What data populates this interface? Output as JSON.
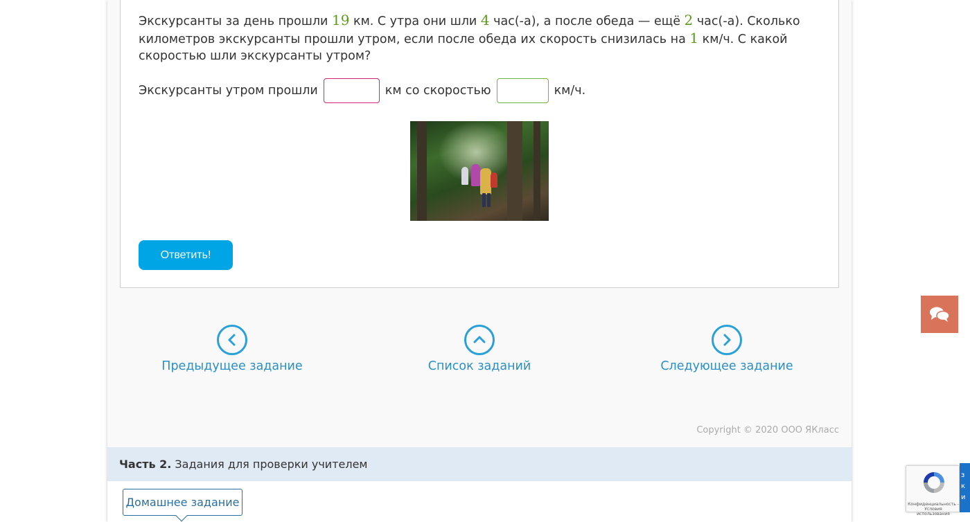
{
  "task": {
    "text_parts": {
      "a": "Экскурсанты за день прошли ",
      "n1": "19",
      "b": " км. С утра они шли ",
      "n2": "4",
      "c": " час(-а), а после обеда — ещё ",
      "n3": "2",
      "d": " час(-а). Сколько километров экскурсанты прошли утром, если после обеда их скорость снизилась на ",
      "n4": "1",
      "e": " км/ч. С какой скоростью шли экскурсанты утром?"
    },
    "answer_prefix": "Экскурсанты утром прошли",
    "answer_middle": "км со скоростью",
    "answer_suffix": "км/ч.",
    "distance_value": "",
    "speed_value": "",
    "submit_label": "Ответить!"
  },
  "navigation": {
    "prev_label": "Предыдущее задание",
    "list_label": "Список заданий",
    "next_label": "Следующее задание"
  },
  "copyright": "Copyright © 2020 ООО ЯКласс",
  "part2": {
    "number": "Часть 2.",
    "title": "Задания для проверки учителем",
    "tab_label": "Домашнее задание"
  },
  "recaptcha": {
    "terms": "Конфиденциальность - Условия использования"
  },
  "side_panel_letters": "з\nк\nи",
  "colors": {
    "accent_blue": "#00a5e6",
    "link_blue": "#2a8fc4",
    "number_green": "#5a9c16",
    "input_pink_border": "#d6237a",
    "input_green_border": "#6cb33f",
    "chat_orange": "#d9735a",
    "part2_bg": "#dfeaf4"
  },
  "icons": {
    "prev": "chevron-left-circle-icon",
    "list": "chevron-up-circle-icon",
    "next": "chevron-right-circle-icon",
    "chat": "chat-bubbles-icon",
    "recaptcha": "recaptcha-logo-icon"
  }
}
